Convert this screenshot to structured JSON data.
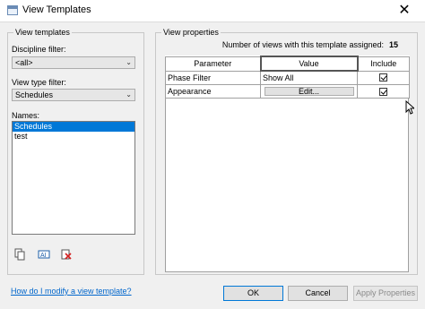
{
  "window": {
    "title": "View Templates",
    "close_glyph": "✕"
  },
  "left_group": {
    "legend": "View templates",
    "discipline_filter_label": "Discipline filter:",
    "discipline_filter_value": "<all>",
    "view_type_filter_label": "View type filter:",
    "view_type_filter_value": "Schedules",
    "names_label": "Names:",
    "names": [
      "Schedules",
      "test"
    ],
    "tools": [
      "duplicate-icon",
      "rename-icon",
      "delete-icon"
    ]
  },
  "right_group": {
    "legend": "View properties",
    "count_label": "Number of views with this template assigned:",
    "count_value": "15",
    "columns": [
      "Parameter",
      "Value",
      "Include"
    ],
    "rows": [
      {
        "parameter": "Phase Filter",
        "value": "Show All",
        "include": true
      },
      {
        "parameter": "Appearance",
        "value": "Edit...",
        "include": true
      }
    ]
  },
  "footer": {
    "help_link": "How do I modify a view template?",
    "ok": "OK",
    "cancel": "Cancel",
    "apply": "Apply Properties"
  },
  "colors": {
    "selection": "#0078d7",
    "link": "#0066cc"
  }
}
